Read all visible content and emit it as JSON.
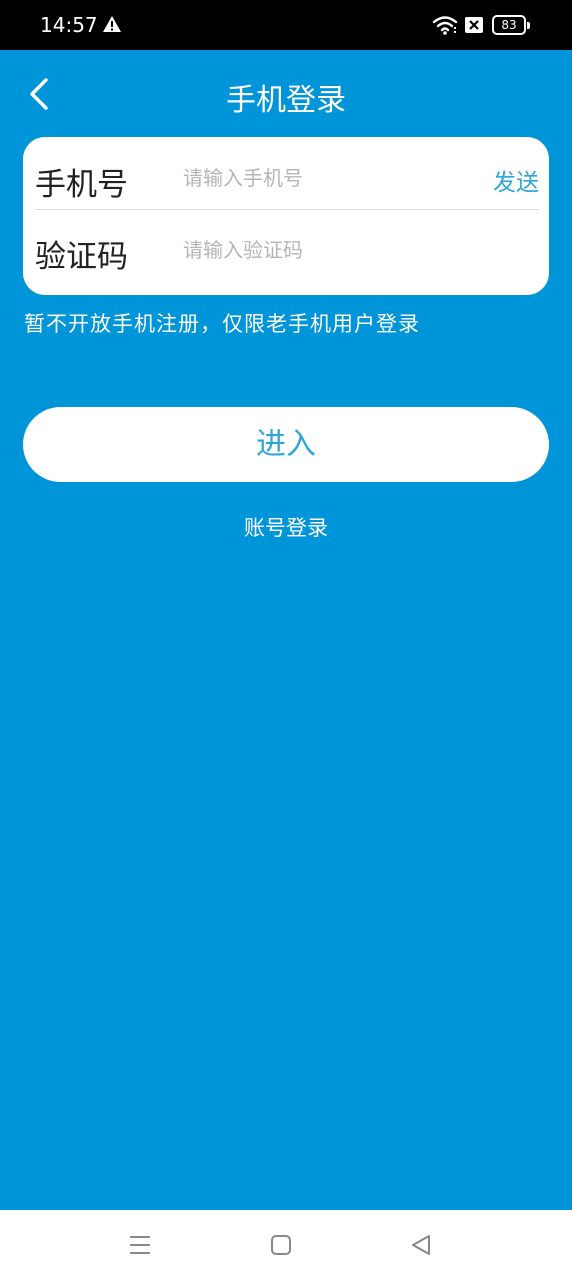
{
  "status_bar": {
    "time": "14:57",
    "battery": "83",
    "icons": [
      "warning-icon",
      "wifi-icon",
      "sim-off-icon",
      "battery-icon"
    ]
  },
  "header": {
    "title": "手机登录",
    "back_icon": "chevron-left-icon"
  },
  "form": {
    "phone": {
      "label": "手机号",
      "placeholder": "请输入手机号",
      "value": "",
      "send_label": "发送"
    },
    "code": {
      "label": "验证码",
      "placeholder": "请输入验证码",
      "value": ""
    }
  },
  "notice": "暂不开放手机注册，仅限老手机用户登录",
  "actions": {
    "enter_label": "进入",
    "account_login_label": "账号登录"
  },
  "system_nav": {
    "icons": [
      "menu-icon",
      "home-icon",
      "back-triangle-icon"
    ]
  },
  "colors": {
    "background": "#0094d8",
    "accent": "#2fa6d8",
    "card": "#ffffff"
  }
}
